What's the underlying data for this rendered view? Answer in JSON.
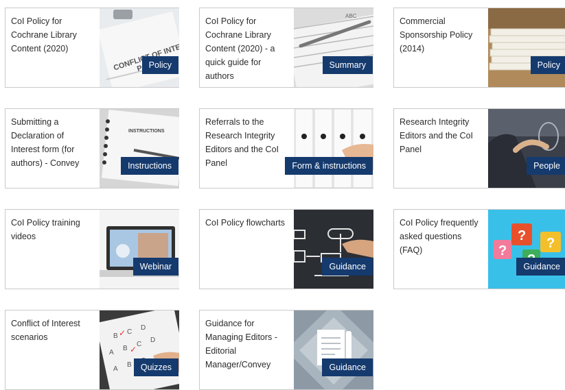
{
  "cards": [
    {
      "title": "CoI Policy for Cochrane Library Content (2020)",
      "badge": "Policy",
      "image_icon": "conflict-of-interest-document-icon"
    },
    {
      "title": "CoI Policy for Cochrane Library Content (2020) - a quick guide for authors",
      "badge": "Summary",
      "image_icon": "notebook-pen-icon"
    },
    {
      "title": "Commercial Sponsorship Policy (2014)",
      "badge": "Policy",
      "image_icon": "paper-stack-icon"
    },
    {
      "title": "Submitting a Declaration of Interest form (for authors) - Convey",
      "badge": "Instructions",
      "image_icon": "instructions-booklet-icon"
    },
    {
      "title": "Referrals to the Research Integrity Editors and the CoI Panel",
      "badge": "Form & instructions",
      "image_icon": "binders-hand-icon"
    },
    {
      "title": "Research Integrity Editors and the CoI Panel",
      "badge": "People",
      "image_icon": "person-glasses-icon"
    },
    {
      "title": "CoI Policy training videos",
      "badge": "Webinar",
      "image_icon": "laptop-video-icon"
    },
    {
      "title": "CoI Policy flowcharts",
      "badge": "Guidance",
      "image_icon": "flowchart-board-icon"
    },
    {
      "title": "CoI Policy frequently asked questions (FAQ)",
      "badge": "Guidance",
      "image_icon": "question-bubbles-icon"
    },
    {
      "title": "Conflict of Interest scenarios",
      "badge": "Quizzes",
      "image_icon": "quiz-tablet-icon"
    },
    {
      "title": "Guidance for Managing Editors - Editorial Manager/Convey",
      "badge": "Guidance",
      "image_icon": "document-pen-icon"
    }
  ],
  "colors": {
    "badge_bg": "#153a6e",
    "badge_text": "#ffffff",
    "border": "#c9c9c9",
    "text": "#2b2b2b"
  }
}
